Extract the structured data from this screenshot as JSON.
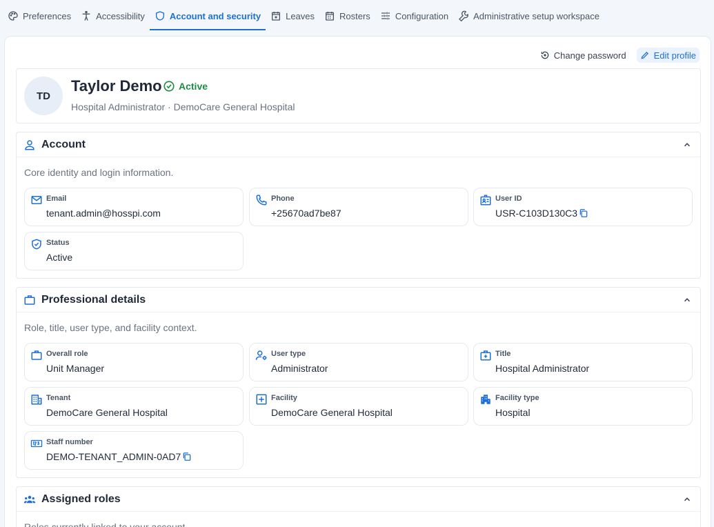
{
  "tabs": [
    {
      "label": "Preferences",
      "icon": "palette-icon"
    },
    {
      "label": "Accessibility",
      "icon": "accessibility-icon"
    },
    {
      "label": "Account and security",
      "icon": "shield-icon",
      "active": true
    },
    {
      "label": "Leaves",
      "icon": "calendar-x-icon"
    },
    {
      "label": "Rosters",
      "icon": "calendar-icon"
    },
    {
      "label": "Configuration",
      "icon": "sliders-icon"
    },
    {
      "label": "Administrative setup workspace",
      "icon": "wrench-icon"
    }
  ],
  "actions": {
    "change_password": "Change password",
    "edit_profile": "Edit profile"
  },
  "profile": {
    "initials": "TD",
    "name": "Taylor Demo",
    "status": "Active",
    "subtitle": "Hospital Administrator · DemoCare General Hospital"
  },
  "sections": {
    "account": {
      "title": "Account",
      "description": "Core identity and login information.",
      "fields": {
        "email": {
          "label": "Email",
          "value": "tenant.admin@hosspi.com"
        },
        "phone": {
          "label": "Phone",
          "value": "+25670ad7be87"
        },
        "user_id": {
          "label": "User ID",
          "value": "USR-C103D130C3"
        },
        "status": {
          "label": "Status",
          "value": "Active"
        }
      }
    },
    "professional": {
      "title": "Professional details",
      "description": "Role, title, user type, and facility context.",
      "fields": {
        "overall_role": {
          "label": "Overall role",
          "value": "Unit Manager"
        },
        "user_type": {
          "label": "User type",
          "value": "Administrator"
        },
        "title": {
          "label": "Title",
          "value": "Hospital Administrator"
        },
        "tenant": {
          "label": "Tenant",
          "value": "DemoCare General Hospital"
        },
        "facility": {
          "label": "Facility",
          "value": "DemoCare General Hospital"
        },
        "facility_type": {
          "label": "Facility type",
          "value": "Hospital"
        },
        "staff_number": {
          "label": "Staff number",
          "value": "DEMO-TENANT_ADMIN-0AD7"
        }
      }
    },
    "roles": {
      "title": "Assigned roles",
      "description": "Roles currently linked to your account."
    }
  },
  "colors": {
    "accent": "#1d6fd8",
    "success": "#1e8c45",
    "border": "#e5e9ef"
  }
}
